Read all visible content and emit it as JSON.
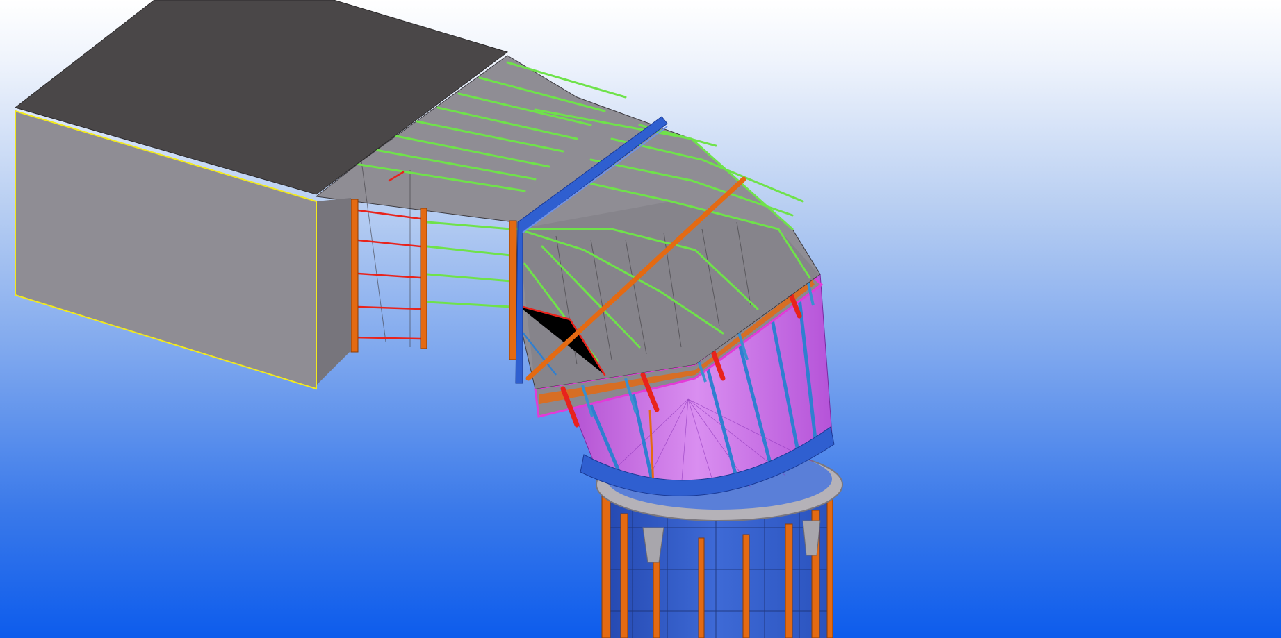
{
  "viewport": {
    "background_top": "#ffffff",
    "background_bottom": "#0d5cec"
  },
  "model": {
    "elements": [
      {
        "name": "rectangular-duct",
        "color": "#8f8d94",
        "top_color": "#4a4748"
      },
      {
        "name": "selected-edge-highlight",
        "color": "#f2ea1c"
      },
      {
        "name": "bend-stiffener-green",
        "color": "#6fe24a"
      },
      {
        "name": "stiffener-red",
        "color": "#e8231c"
      },
      {
        "name": "support-column-orange",
        "color": "#e46a12"
      },
      {
        "name": "flange-frame-blue",
        "color": "#2f5fd0"
      },
      {
        "name": "expansion-joint",
        "color": "#e33ad8"
      },
      {
        "name": "transition-cone",
        "color": "#cc5ee0"
      },
      {
        "name": "chimney-stack",
        "color": "#2f59c6"
      },
      {
        "name": "support-platform-ring",
        "color": "#b5b2b8"
      }
    ]
  }
}
